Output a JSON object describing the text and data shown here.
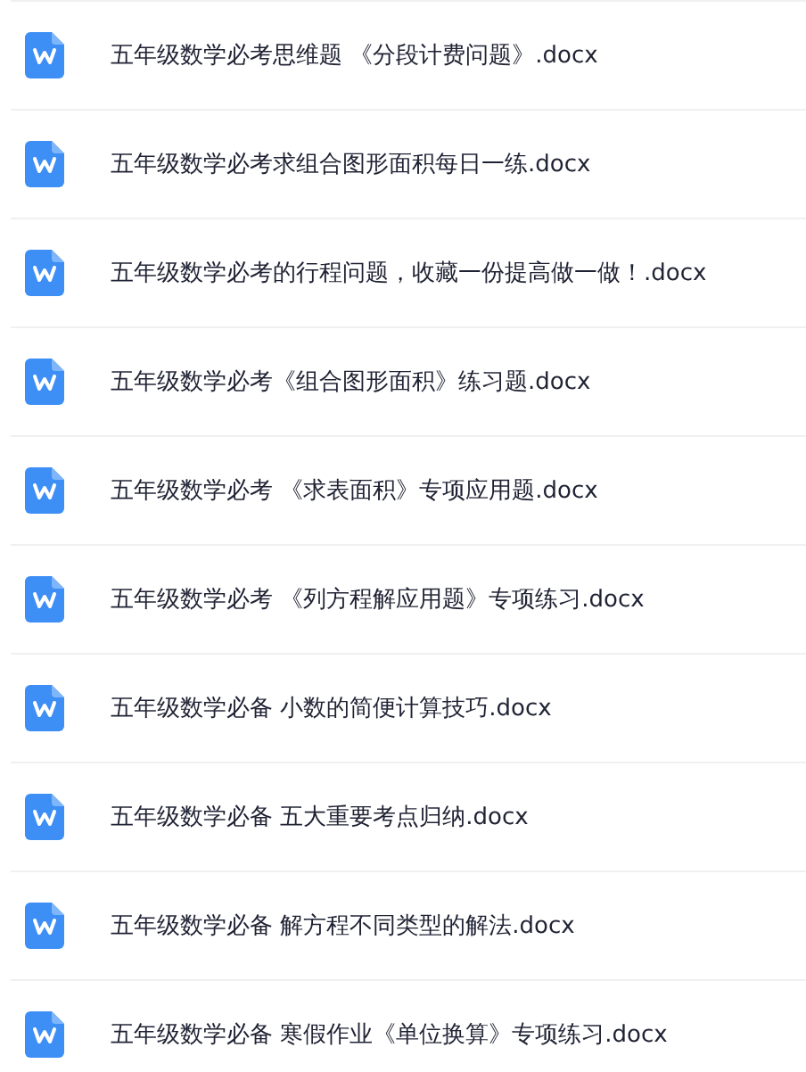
{
  "files": [
    {
      "name": "五年级数学必考思维题 《分段计费问题》.docx"
    },
    {
      "name": "五年级数学必考求组合图形面积每日一练.docx"
    },
    {
      "name": "五年级数学必考的行程问题，收藏一份提高做一做！.docx"
    },
    {
      "name": "五年级数学必考《组合图形面积》练习题.docx"
    },
    {
      "name": "五年级数学必考 《求表面积》专项应用题.docx"
    },
    {
      "name": "五年级数学必考 《列方程解应用题》专项练习.docx"
    },
    {
      "name": "五年级数学必备 小数的简便计算技巧.docx"
    },
    {
      "name": "五年级数学必备 五大重要考点归纳.docx"
    },
    {
      "name": "五年级数学必备 解方程不同类型的解法.docx"
    },
    {
      "name": "五年级数学必备 寒假作业《单位换算》专项练习.docx"
    }
  ]
}
